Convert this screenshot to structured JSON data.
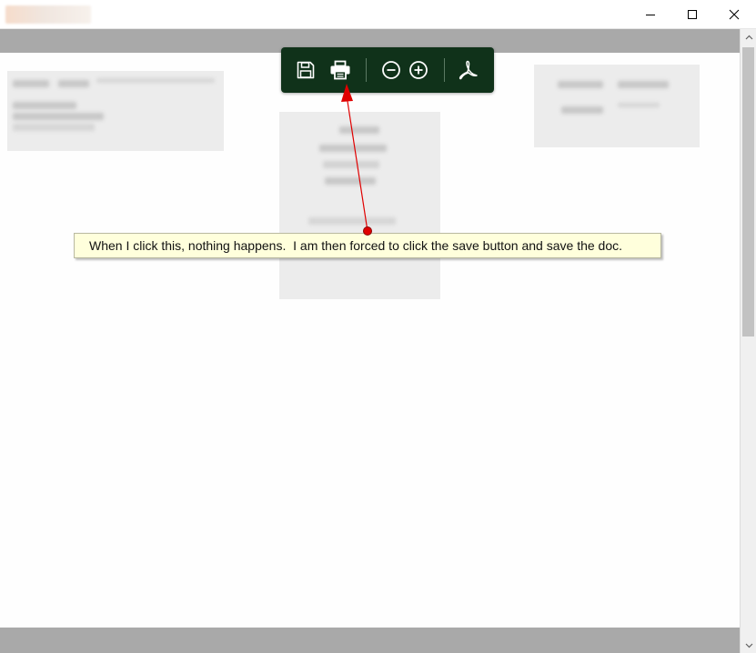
{
  "window": {
    "app_icon": "blurred-app-logo",
    "controls": {
      "minimize_icon": "minimize-icon",
      "maximize_icon": "maximize-icon",
      "close_icon": "close-icon"
    }
  },
  "toolbar": {
    "background": "#10321a",
    "icon_color": "#ffffff",
    "buttons": [
      {
        "name": "save",
        "icon": "floppy-disk-icon"
      },
      {
        "name": "print",
        "icon": "printer-icon"
      },
      {
        "name": "zoom-out",
        "icon": "zoom-out-icon"
      },
      {
        "name": "zoom-in",
        "icon": "zoom-in-icon"
      },
      {
        "name": "pdf",
        "icon": "acrobat-pdf-icon"
      }
    ]
  },
  "annotation": {
    "text": "When I click this, nothing happens.  I am then forced to click the save button and save the doc.",
    "background": "#ffffdc",
    "arrow_color": "#e00000",
    "points_to": "print"
  },
  "document": {
    "content_state": "blurred",
    "scrollbar": true
  }
}
